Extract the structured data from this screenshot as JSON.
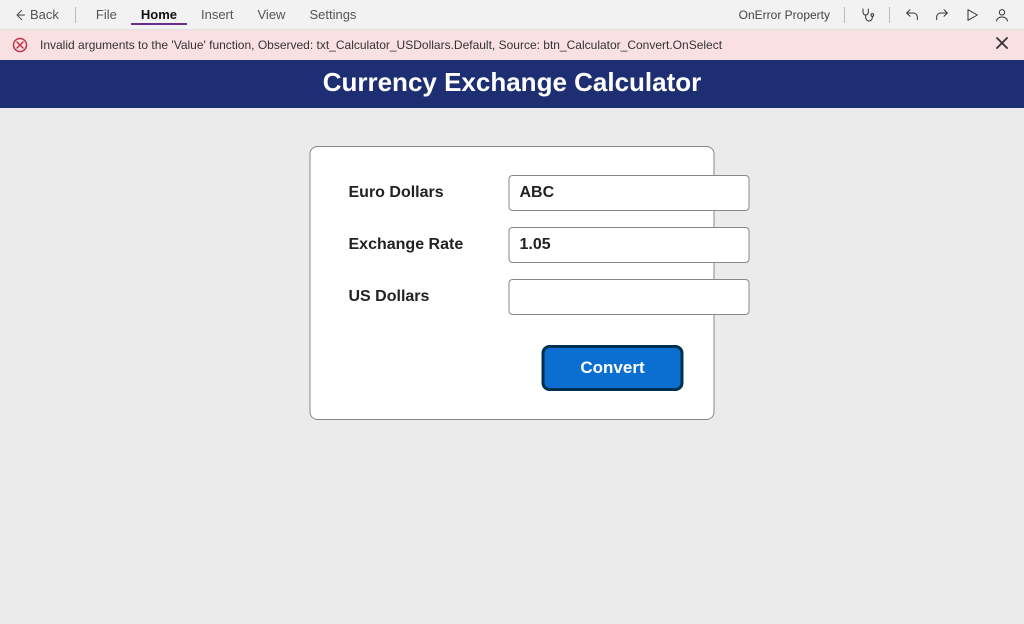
{
  "menubar": {
    "back": "Back",
    "items": [
      "File",
      "Home",
      "Insert",
      "View",
      "Settings"
    ],
    "active_index": 1,
    "property_label": "OnError Property"
  },
  "error": {
    "message": "Invalid arguments to the 'Value' function, Observed: txt_Calculator_USDollars.Default, Source: btn_Calculator_Convert.OnSelect"
  },
  "app": {
    "title": "Currency Exchange Calculator"
  },
  "form": {
    "euro_label": "Euro Dollars",
    "euro_value": "ABC",
    "rate_label": "Exchange Rate",
    "rate_value": "1.05",
    "usd_label": "US Dollars",
    "usd_value": "",
    "convert_label": "Convert"
  }
}
